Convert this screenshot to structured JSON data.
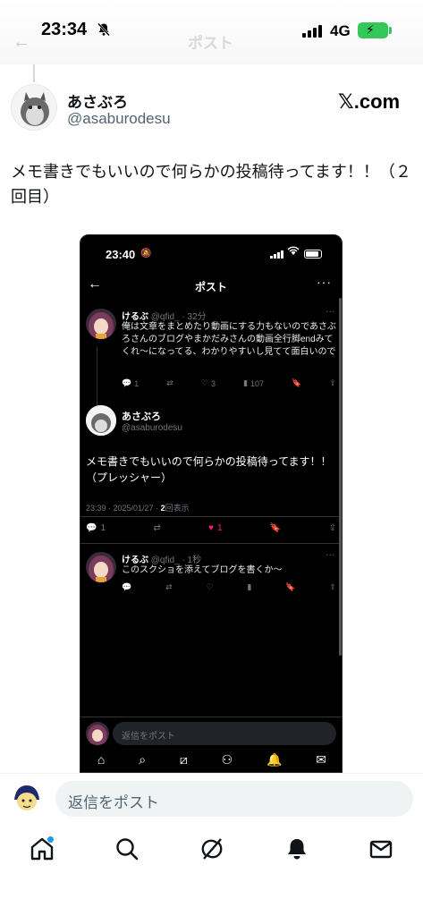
{
  "status_bar": {
    "time": "23:34",
    "network": "4G",
    "header_title": "ポスト"
  },
  "author": {
    "name": "あさぶろ",
    "handle": "@asaburodesu",
    "source": "𝕏.com"
  },
  "tweet": {
    "text": "メモ書きでもいいので何らかの投稿待ってます！！（２回目）"
  },
  "embedded": {
    "time": "23:40",
    "title": "ポスト",
    "reply1": {
      "name": "けるぶ",
      "handle": "@qfid_",
      "age": "· 32分",
      "text": "俺は文章をまとめたり動画にする力もないのであさぶろさんのブログやまかだみさんの動画全行脚endみてくれ〜になってる、わかりやすいし見てて面白いので",
      "replies": "1",
      "likes": "3",
      "views": "107"
    },
    "main": {
      "name": "あさぶろ",
      "handle": "@asaburodesu",
      "text": "メモ書きでもいいので何らかの投稿待ってます！！（プレッシャー）",
      "meta": "23:39 · 2025/01/27 · ",
      "views_count": "2",
      "views_label": "回表示",
      "replies": "1",
      "likes": "1"
    },
    "reply2": {
      "name": "けるぶ",
      "handle": "@qfid_",
      "age": "· 1秒",
      "text": "このスクショを添えてブログを書くか〜"
    },
    "reply_placeholder": "返信をポスト"
  },
  "reply_bar": {
    "placeholder": "返信をポスト"
  },
  "colors": {
    "like_active": "#f91880",
    "accent": "#1d9bf0"
  }
}
